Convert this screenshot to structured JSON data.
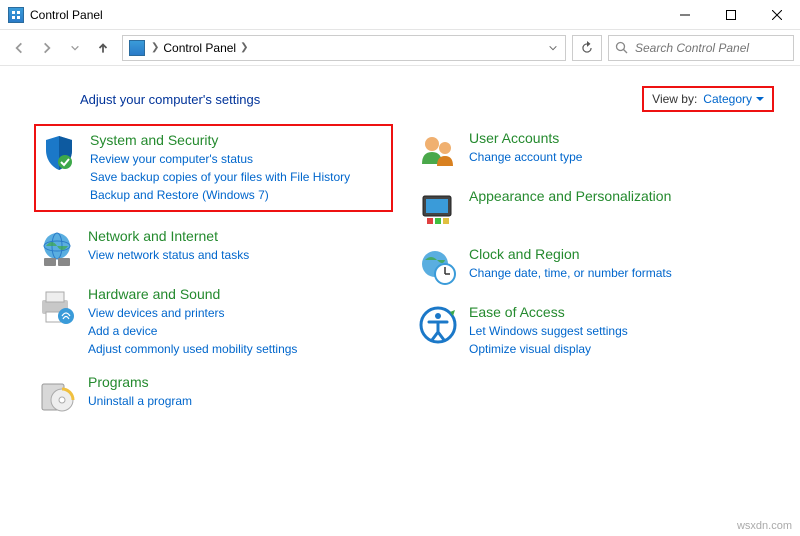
{
  "window": {
    "title": "Control Panel"
  },
  "address": {
    "root": "Control Panel"
  },
  "search": {
    "placeholder": "Search Control Panel"
  },
  "header": {
    "title": "Adjust your computer's settings",
    "viewby_label": "View by:",
    "viewby_value": "Category"
  },
  "left": [
    {
      "title": "System and Security",
      "links": [
        "Review your computer's status",
        "Save backup copies of your files with File History",
        "Backup and Restore (Windows 7)"
      ]
    },
    {
      "title": "Network and Internet",
      "links": [
        "View network status and tasks"
      ]
    },
    {
      "title": "Hardware and Sound",
      "links": [
        "View devices and printers",
        "Add a device",
        "Adjust commonly used mobility settings"
      ]
    },
    {
      "title": "Programs",
      "links": [
        "Uninstall a program"
      ]
    }
  ],
  "right": [
    {
      "title": "User Accounts",
      "links": [
        "Change account type"
      ]
    },
    {
      "title": "Appearance and Personalization",
      "links": []
    },
    {
      "title": "Clock and Region",
      "links": [
        "Change date, time, or number formats"
      ]
    },
    {
      "title": "Ease of Access",
      "links": [
        "Let Windows suggest settings",
        "Optimize visual display"
      ]
    }
  ],
  "watermark": "wsxdn.com"
}
